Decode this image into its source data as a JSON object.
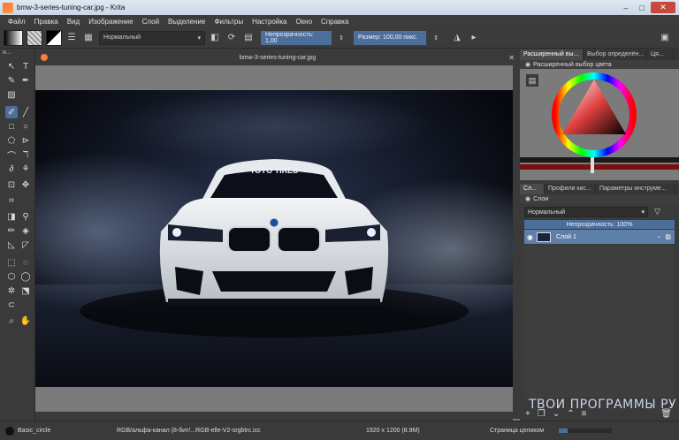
{
  "window": {
    "title": "bmw-3-series-tuning-car.jpg  - Krita",
    "minimize": "–",
    "maximize": "□",
    "close": "✕"
  },
  "menu": [
    "Файл",
    "Правка",
    "Вид",
    "Изображение",
    "Слой",
    "Выделение",
    "Фильтры",
    "Настройка",
    "Окно",
    "Справка"
  ],
  "toolbar": {
    "blend_mode": "Нормальный",
    "opacity_label": "Непрозрачность: 1,00",
    "size_label": "Размер: 100,00 пикс."
  },
  "toolbox": {
    "header": "и..."
  },
  "document": {
    "tab_title": "bmw-3-series-tuning-car.jpg"
  },
  "car": {
    "windshield_banner": "TOYO TIRES"
  },
  "dockers": {
    "top_tabs": [
      "Расширенный вы...",
      "Выбор определён...",
      "Ця..."
    ],
    "color_selector_title": "Расширенный выбор цвета",
    "mid_tabs": [
      "Сл...",
      "Профили кис...",
      "Параметры инструме..."
    ],
    "layers_title": "Слои",
    "layers_blend": "Нормальный",
    "layers_opacity": "Непрозрачность:  100%",
    "layer_name": "Слой 1"
  },
  "status": {
    "brush": "Basic_circle",
    "color_profile": "RGB/альфа-канал (8-бит/...RGB-elle-V2-srgbtrc.icc",
    "dimensions": "1920 x 1200 (8.9M)",
    "zoom_mode": "Страница целиком"
  },
  "watermark": "ТВОИ ПРОГРАММЫ РУ",
  "colors": {
    "accent": "#4c6f9a",
    "panel": "#3a3a3a",
    "canvas_bg": "#7a7a7a"
  }
}
